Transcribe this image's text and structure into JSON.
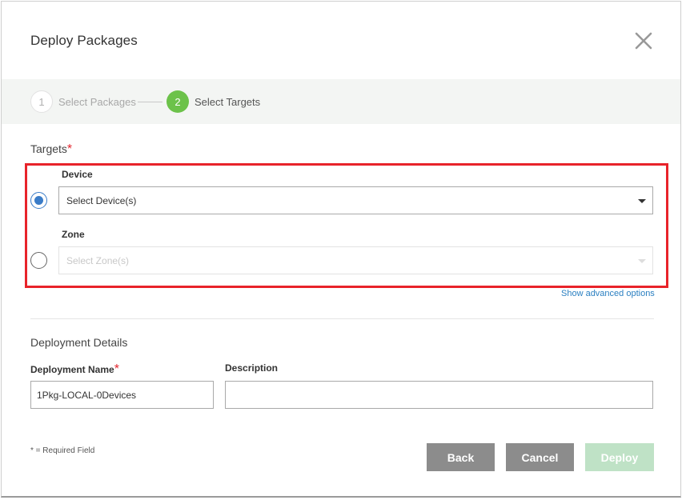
{
  "dialog": {
    "title": "Deploy Packages",
    "close_icon": "close-icon"
  },
  "steps": [
    {
      "number": "1",
      "label": "Select Packages",
      "state": "completed"
    },
    {
      "number": "2",
      "label": "Select Targets",
      "state": "active"
    }
  ],
  "targets": {
    "label": "Targets",
    "required_mark": "*",
    "device": {
      "label": "Device",
      "selected": true,
      "placeholder": "Select Device(s)"
    },
    "zone": {
      "label": "Zone",
      "selected": false,
      "placeholder": "Select Zone(s)"
    },
    "advanced_link": "Show advanced options"
  },
  "deployment": {
    "section_label": "Deployment Details",
    "name_label": "Deployment Name",
    "name_required_mark": "*",
    "name_value": "1Pkg-LOCAL-0Devices",
    "description_label": "Description",
    "description_value": ""
  },
  "footer": {
    "required_note": "* = Required Field",
    "back_label": "Back",
    "cancel_label": "Cancel",
    "deploy_label": "Deploy"
  },
  "colors": {
    "accent_green": "#6cc24a",
    "radio_blue": "#3a7cc8",
    "required_red": "#e3262e",
    "highlight_red": "#e8232a",
    "deploy_disabled": "#bfe2c6",
    "button_gray": "#8c8c8c",
    "link_blue": "#2a7fc1"
  }
}
